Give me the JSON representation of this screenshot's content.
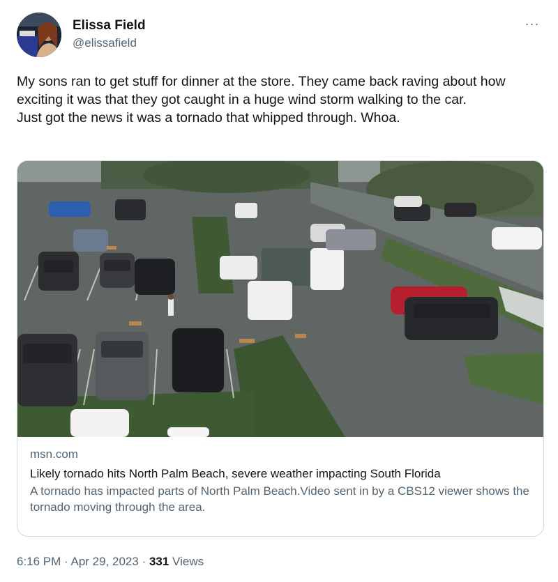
{
  "author": {
    "display_name": "Elissa Field",
    "handle": "@elissafield",
    "avatar_icon": "profile-photo"
  },
  "menu": {
    "more_label": "···"
  },
  "tweet": {
    "line1": "My sons ran to get stuff for dinner at the store. They came back raving about how exciting it was that they got caught in a huge wind storm walking to the car.",
    "line2": "Just got the news it was a tornado that whipped through. Whoa."
  },
  "card": {
    "image_description_icon": "parking-lot-photo",
    "domain": "msn.com",
    "title": "Likely tornado hits North Palm Beach, severe weather impacting South Florida",
    "description": "A tornado has impacted parts of North Palm Beach.Video sent in by a CBS12 viewer shows the tornado moving through the area."
  },
  "meta": {
    "timestamp": "6:16 PM · Apr 29, 2023",
    "separator": " · ",
    "views_count": "331",
    "views_label": " Views"
  }
}
